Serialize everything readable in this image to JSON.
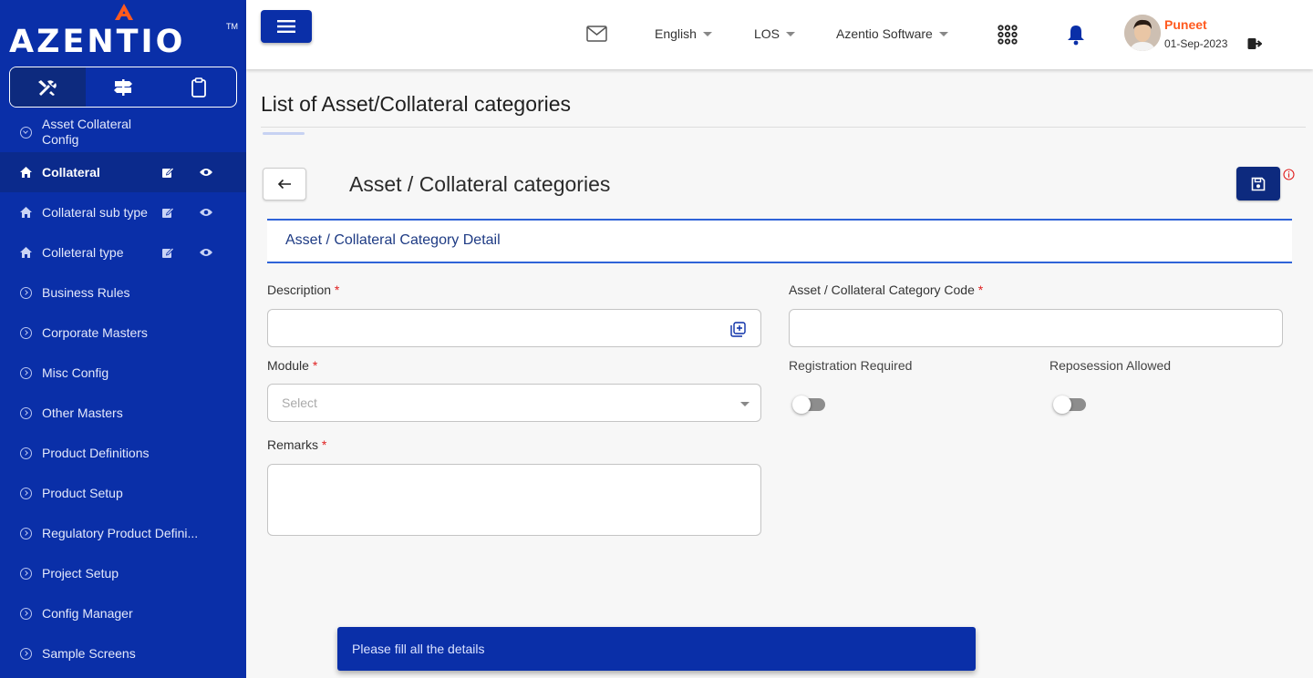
{
  "brand": {
    "logo_text": "AZENTIO",
    "tm": "TM"
  },
  "sidebar": {
    "tabs": [
      {
        "icon": "tools-icon"
      },
      {
        "icon": "signpost-icon"
      },
      {
        "icon": "clipboard-icon"
      }
    ],
    "items": [
      {
        "label": "Asset Collateral Config"
      },
      {
        "label": "Collateral"
      },
      {
        "label": "Collateral sub type"
      },
      {
        "label": "Colleteral type"
      },
      {
        "label": "Business Rules"
      },
      {
        "label": "Corporate Masters"
      },
      {
        "label": "Misc Config"
      },
      {
        "label": "Other Masters"
      },
      {
        "label": "Product Definitions"
      },
      {
        "label": "Product Setup"
      },
      {
        "label": "Regulatory Product Defini..."
      },
      {
        "label": "Project Setup"
      },
      {
        "label": "Config Manager"
      },
      {
        "label": "Sample Screens"
      }
    ]
  },
  "header": {
    "language": "English",
    "module": "LOS",
    "company": "Azentio Software",
    "user": {
      "name": "Puneet",
      "date": "01-Sep-2023"
    }
  },
  "page": {
    "title": "List of Asset/Collateral categories"
  },
  "form": {
    "title": "Asset / Collateral categories",
    "section_title": "Asset / Collateral Category Detail",
    "description_label": "Description",
    "code_label": "Asset / Collateral Category Code",
    "module_label": "Module",
    "module_placeholder": "Select",
    "registration_label": "Registration Required",
    "repossession_label": "Reposession Allowed",
    "remarks_label": "Remarks",
    "required_mark": "*",
    "registration_on": false,
    "repossession_on": false
  },
  "snackbar": {
    "message": "Please fill all the details"
  },
  "colors": {
    "sidebar": "#0a2fa8",
    "accent": "#0d2a7e",
    "user_name": "#ff5a1f",
    "required": "#e02020"
  }
}
